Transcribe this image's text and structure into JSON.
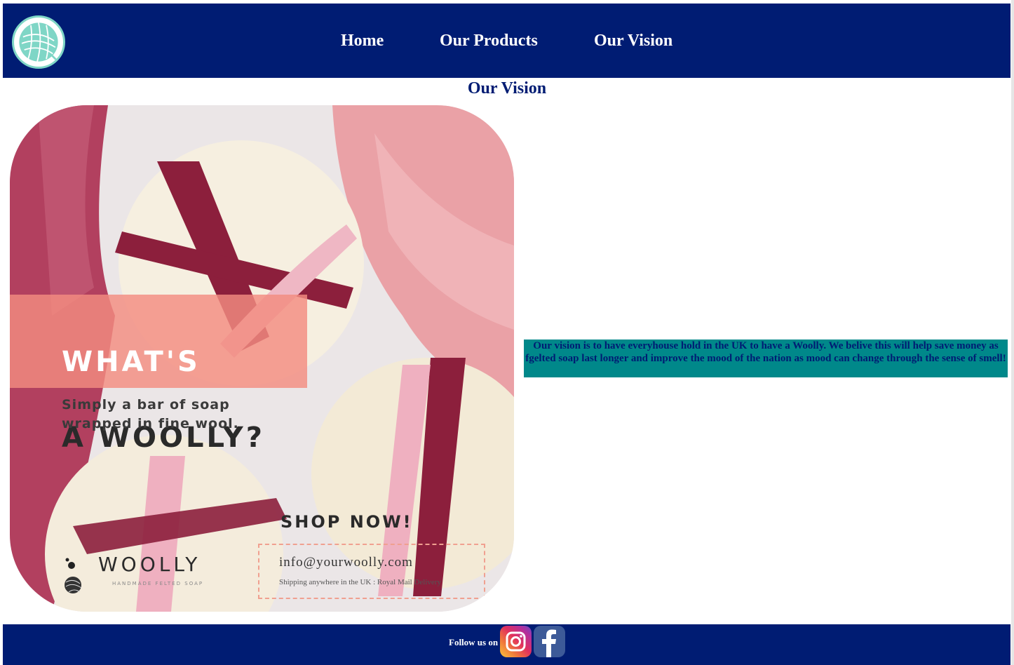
{
  "header": {
    "logo_label": "Woolly logo",
    "nav": [
      {
        "label": "Home"
      },
      {
        "label": "Our Products"
      },
      {
        "label": "Our Vision"
      }
    ]
  },
  "main": {
    "title": "Our Vision",
    "promo": {
      "headline_line1": "WHAT'S",
      "headline_line2": "A WOOLLY?",
      "subtext": "Simply a bar of soap wrapped in fine wool.",
      "cta": "SHOP NOW!",
      "email": "info@yourwoolly.com",
      "shipping": "Shipping anywhere in the UK : Royal Mail Delivery",
      "brand": "WOOLLY",
      "brand_sub": "HANDMADE FELTED SOAP"
    },
    "vision_text": "Our vision is to have everyhouse hold in the UK to have a Woolly. We belive this will help save money as fgelted soap last longer and improve the mood of the nation as mood can change through the sense of smell!"
  },
  "footer": {
    "follow_label": "Follow us on",
    "social": [
      {
        "icon": "instagram-icon"
      },
      {
        "icon": "facebook-icon"
      }
    ]
  },
  "colors": {
    "navy": "#001c73",
    "teal": "#00888a",
    "logo_mint": "#7fd6c6",
    "promo_band": "#f38c80"
  }
}
